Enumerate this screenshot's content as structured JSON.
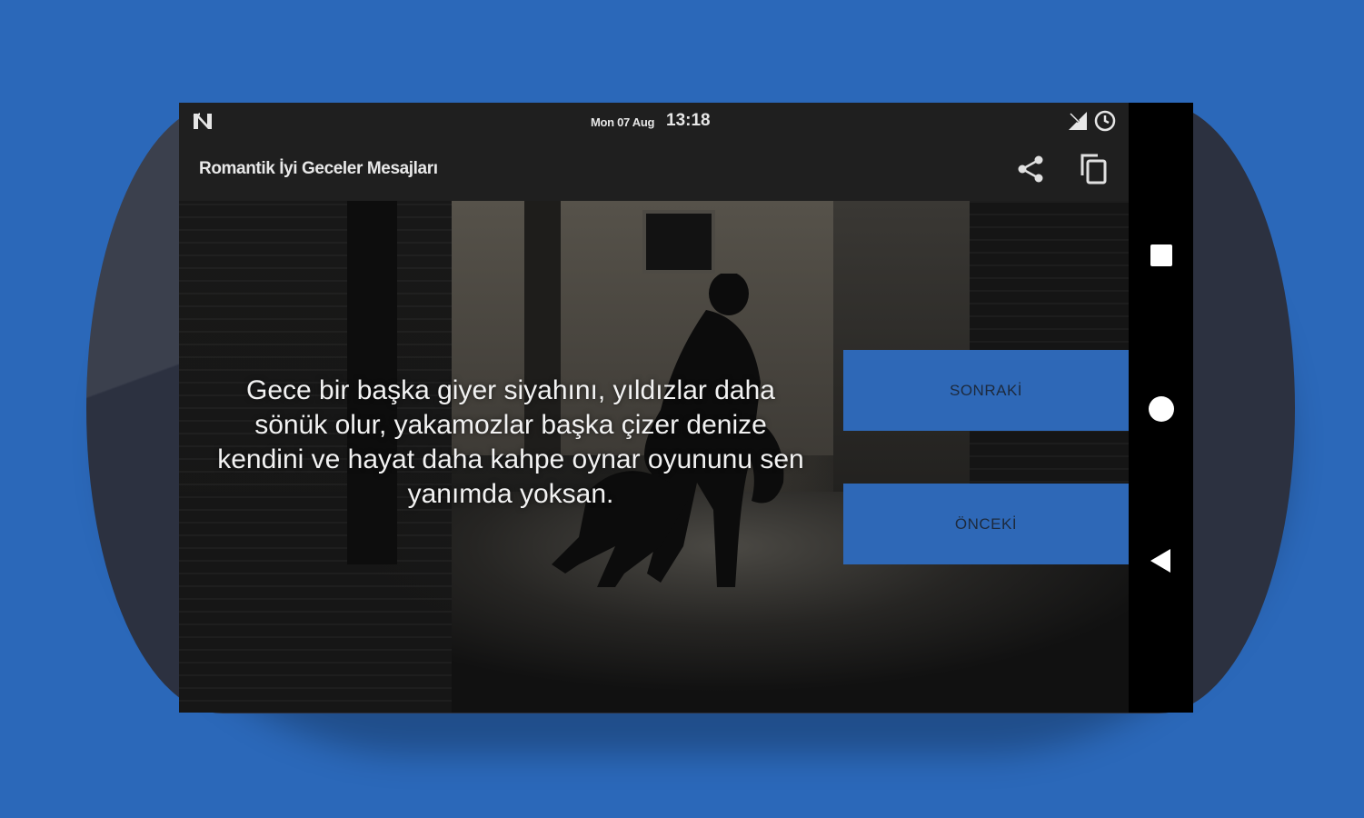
{
  "colors": {
    "background": "#2b68b9",
    "device": "#2c3140",
    "bars": "#1f1f1f",
    "button": "#2e68b7",
    "button_text": "#1d2a3d"
  },
  "statusbar": {
    "notification_icon": "n-icon",
    "date": "Mon 07 Aug",
    "time": "13:18",
    "signal_icon": "signal-icon",
    "alarm_icon": "alarm-icon"
  },
  "toolbar": {
    "title": "Romantik İyi Geceler Mesajları",
    "share_icon": "share-icon",
    "copy_icon": "copy-icon"
  },
  "content": {
    "quote": "Gece bir başka giyer siyahını, yıldızlar daha sönük olur, yakamozlar başka çizer denize kendini ve hayat daha kahpe oynar oyununu sen yanımda yoksan."
  },
  "buttons": {
    "next_label": "SONRAKİ",
    "prev_label": "ÖNCEKİ"
  },
  "navbar": {
    "recents_icon": "square-icon",
    "home_icon": "circle-icon",
    "back_icon": "triangle-back-icon"
  }
}
